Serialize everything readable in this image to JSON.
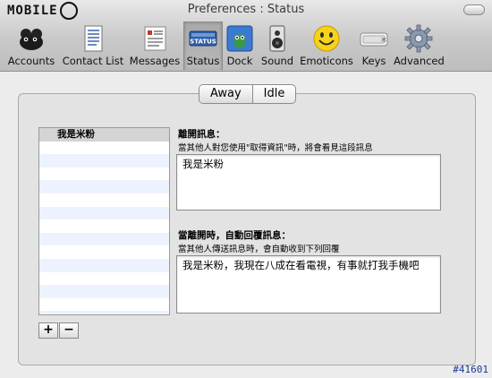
{
  "window": {
    "title": "Preferences : Status"
  },
  "watermark": {
    "logo_text": "MOBILE"
  },
  "toolbar": {
    "items": [
      {
        "label": "Accounts",
        "icon": "accounts-icon"
      },
      {
        "label": "Contact List",
        "icon": "contact-list-icon"
      },
      {
        "label": "Messages",
        "icon": "messages-icon"
      },
      {
        "label": "Status",
        "icon": "status-icon",
        "icon_text": "STATUS",
        "selected": true
      },
      {
        "label": "Dock",
        "icon": "dock-icon"
      },
      {
        "label": "Sound",
        "icon": "speaker-icon"
      },
      {
        "label": "Emoticons",
        "icon": "smiley-icon"
      },
      {
        "label": "Keys",
        "icon": "keyboard-icon"
      },
      {
        "label": "Advanced",
        "icon": "gear-icon"
      }
    ]
  },
  "tabs": {
    "away": "Away",
    "idle": "Idle",
    "selected": "Away"
  },
  "status_list": {
    "items": [
      "我是米粉"
    ],
    "selected": "我是米粉"
  },
  "list_controls": {
    "add": "+",
    "remove": "−"
  },
  "away_message": {
    "title": "離開訊息：",
    "description": "當其他人對您使用\"取得資訊\"時，將會看見這段訊息",
    "value": "我是米粉"
  },
  "auto_reply": {
    "title": "當離開時，自動回覆訊息：",
    "description": "當其他人傳送訊息時，會自動收到下列回覆",
    "value": "我是米粉，我現在八成在看電視，有事就打我手機吧"
  },
  "footer_tag": "#41601"
}
